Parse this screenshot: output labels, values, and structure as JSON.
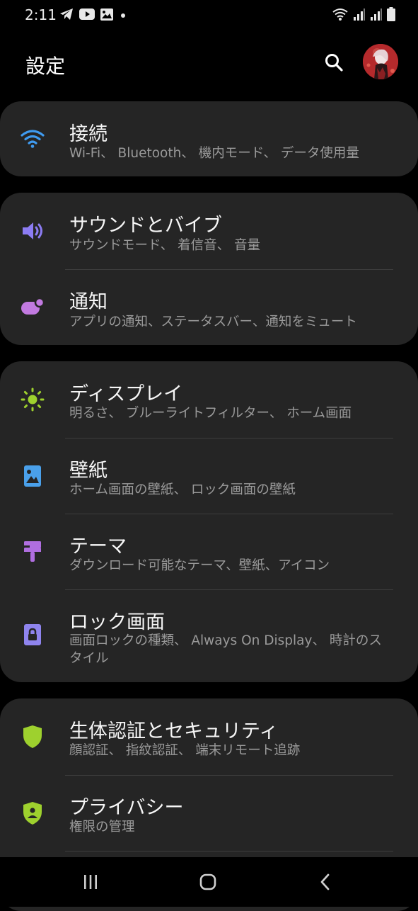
{
  "status_bar": {
    "time": "2:11"
  },
  "header": {
    "title": "設定"
  },
  "colors": {
    "background": "#000000",
    "card": "#252525",
    "wifi": "#3f9bf0",
    "sound": "#8c7cf3",
    "notifications": "#c27ae0",
    "display": "#9ed12e",
    "wallpaper": "#4aa0ea",
    "themes": "#b06ee0",
    "lock_screen": "#8f84ee",
    "security": "#9ed12e",
    "privacy": "#9ed12e"
  },
  "groups": [
    {
      "items": [
        {
          "icon": "wifi-icon",
          "title": "接続",
          "subtitle": "Wi-Fi、 Bluetooth、 機内モード、 データ使用量"
        }
      ]
    },
    {
      "items": [
        {
          "icon": "volume-icon",
          "title": "サウンドとバイブ",
          "subtitle": "サウンドモード、 着信音、 音量"
        },
        {
          "icon": "notification-icon",
          "title": "通知",
          "subtitle": "アプリの通知、ステータスバー、通知をミュート"
        }
      ]
    },
    {
      "items": [
        {
          "icon": "brightness-icon",
          "title": "ディスプレイ",
          "subtitle": "明るさ、 ブルーライトフィルター、 ホーム画面"
        },
        {
          "icon": "wallpaper-icon",
          "title": "壁紙",
          "subtitle": "ホーム画面の壁紙、 ロック画面の壁紙"
        },
        {
          "icon": "theme-brush-icon",
          "title": "テーマ",
          "subtitle": "ダウンロード可能なテーマ、壁紙、アイコン"
        },
        {
          "icon": "lock-icon",
          "title": "ロック画面",
          "subtitle": "画面ロックの種類、 Always On Display、 時計のスタイル"
        }
      ]
    },
    {
      "items": [
        {
          "icon": "shield-icon",
          "title": "生体認証とセキュリティ",
          "subtitle": "顔認証、 指紋認証、 端末リモート追跡"
        },
        {
          "icon": "privacy-shield-icon",
          "title": "プライバシー",
          "subtitle": "権限の管理"
        }
      ]
    }
  ]
}
